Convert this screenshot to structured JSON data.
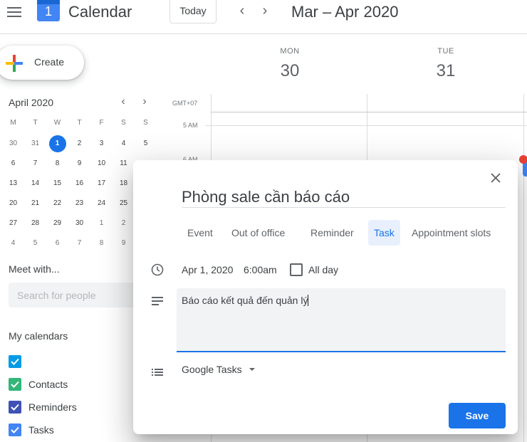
{
  "header": {
    "app_title": "Calendar",
    "logo_day": "1",
    "today_label": "Today",
    "prev_label": "‹",
    "next_label": "›",
    "date_range": "Mar – Apr 2020"
  },
  "sidebar": {
    "create_label": "Create",
    "mini_calendar": {
      "title": "April 2020",
      "prev_label": "‹",
      "next_label": "›",
      "weekdays": [
        "M",
        "T",
        "W",
        "T",
        "F",
        "S",
        "S"
      ],
      "weeks": [
        [
          "30",
          "31",
          "1",
          "2",
          "3",
          "4",
          "5"
        ],
        [
          "6",
          "7",
          "8",
          "9",
          "10",
          "11",
          ""
        ],
        [
          "13",
          "14",
          "15",
          "16",
          "17",
          "18",
          ""
        ],
        [
          "20",
          "21",
          "22",
          "23",
          "24",
          "25",
          ""
        ],
        [
          "27",
          "28",
          "29",
          "30",
          "1",
          "2",
          ""
        ],
        [
          "4",
          "5",
          "6",
          "7",
          "8",
          "9",
          ""
        ]
      ],
      "selected_day": "1"
    },
    "meet_with_title": "Meet with...",
    "search_placeholder": "Search for people",
    "my_calendars_title": "My calendars",
    "calendars": [
      {
        "label": "",
        "color": "#039be5"
      },
      {
        "label": "Contacts",
        "color": "#33b679"
      },
      {
        "label": "Reminders",
        "color": "#3f51b5"
      },
      {
        "label": "Tasks",
        "color": "#4285f4"
      }
    ]
  },
  "grid": {
    "timezone": "GMT+07",
    "days": [
      {
        "dow": "MON",
        "num": "30"
      },
      {
        "dow": "TUE",
        "num": "31"
      }
    ],
    "time_labels": [
      "5 AM",
      "6 AM"
    ]
  },
  "dialog": {
    "title_value": "Phòng sale cần báo cáo",
    "tabs": [
      {
        "label": "Event",
        "active": false
      },
      {
        "label": "Out of office",
        "active": false
      },
      {
        "label": "Reminder",
        "active": false
      },
      {
        "label": "Task",
        "active": true
      },
      {
        "label": "Appointment slots",
        "active": false
      }
    ],
    "date": "Apr 1, 2020",
    "time": "6:00am",
    "all_day_label": "All day",
    "all_day_checked": false,
    "description": "Báo cáo kết quả đến quản lý",
    "task_list": "Google Tasks",
    "save_label": "Save"
  },
  "colors": {
    "accent": "#1a73e8",
    "active_tab_bg": "#e8f0fe"
  }
}
